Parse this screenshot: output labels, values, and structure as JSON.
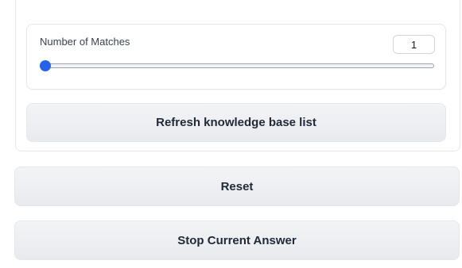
{
  "matches": {
    "label": "Number of Matches",
    "value": "1",
    "slider_fraction": 0.0
  },
  "buttons": {
    "refresh": "Refresh knowledge base list",
    "reset": "Reset",
    "stop": "Stop Current Answer"
  },
  "colors": {
    "accent": "#2563eb",
    "button_bg": "#eceef1",
    "border": "#e5e7eb"
  }
}
